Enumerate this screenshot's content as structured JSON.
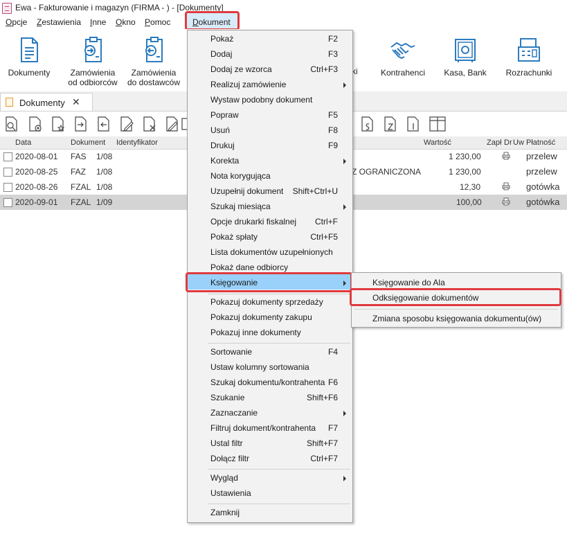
{
  "window": {
    "title": "Ewa - Fakturowanie i magazyn (FIRMA - ) - [Dokumenty]"
  },
  "menubar": [
    "Opcje",
    "Zestawienia",
    "Inne",
    "Okno",
    "Pomoc",
    "Dokument"
  ],
  "ribbon": {
    "dokumenty": "Dokumenty",
    "zam_odb_1": "Zamówienia",
    "zam_odb_2": "od odbiorców",
    "zam_dost_1": "Zamówienia",
    "zam_dost_2": "do dostawców",
    "partial": "ki",
    "kontrahenci": "Kontrahenci",
    "kasa": "Kasa, Bank",
    "rozrachunki": "Rozrachunki"
  },
  "tab": {
    "label": "Dokumenty",
    "close": "✕"
  },
  "grid": {
    "headers": {
      "data": "Data",
      "dokument": "Dokument",
      "identyfikator": "Identyfikator",
      "wartosc": "Wartość",
      "zapl": "Zapł",
      "dr": "Dr",
      "uw": "Uw",
      "platnosc": "Płatność"
    },
    "rows": [
      {
        "date": "2020-08-01",
        "type": "FAS",
        "num": "1/08",
        "name": "",
        "value": "1 230,00",
        "printer": true,
        "payment": "przelew",
        "selected": false
      },
      {
        "date": "2020-08-25",
        "type": "FAZ",
        "num": "1/08",
        "name": "Z OGRANICZONA",
        "value": "1 230,00",
        "printer": false,
        "payment": "przelew",
        "selected": false
      },
      {
        "date": "2020-08-26",
        "type": "FZAL",
        "num": "1/08",
        "name": "",
        "value": "12,30",
        "printer": true,
        "payment": "gotówka",
        "selected": false
      },
      {
        "date": "2020-09-01",
        "type": "FZAL",
        "num": "1/09",
        "name": "",
        "value": "100,00",
        "printer": true,
        "payment": "gotówka",
        "selected": true
      }
    ]
  },
  "dropdown": {
    "items": [
      {
        "label": "Pokaż",
        "shortcut": "F2"
      },
      {
        "label": "Dodaj",
        "shortcut": "F3"
      },
      {
        "label": "Dodaj ze wzorca",
        "shortcut": "Ctrl+F3"
      },
      {
        "label": "Realizuj zamówienie",
        "shortcut": ""
      },
      {
        "label": "Wystaw podobny dokument",
        "shortcut": ""
      },
      {
        "label": "Popraw",
        "shortcut": "F5"
      },
      {
        "label": "Usuń",
        "shortcut": "F8"
      },
      {
        "label": "Drukuj",
        "shortcut": "F9"
      },
      {
        "label": "Korekta",
        "shortcut": ""
      },
      {
        "label": "Nota korygująca",
        "shortcut": ""
      },
      {
        "label": "Uzupełnij dokument",
        "shortcut": "Shift+Ctrl+U"
      },
      {
        "label": "Szukaj miesiąca",
        "shortcut": ""
      },
      {
        "label": "Opcje drukarki fiskalnej",
        "shortcut": "Ctrl+F"
      },
      {
        "label": "Pokaż spłaty",
        "shortcut": "Ctrl+F5"
      },
      {
        "label": "Lista dokumentów uzupełnionych",
        "shortcut": ""
      },
      {
        "label": "Pokaż dane odbiorcy",
        "shortcut": ""
      },
      {
        "label": "Księgowanie",
        "shortcut": ""
      },
      {
        "label": "Pokazuj dokumenty sprzedaży",
        "shortcut": ""
      },
      {
        "label": "Pokazuj dokumenty zakupu",
        "shortcut": ""
      },
      {
        "label": "Pokazuj inne dokumenty",
        "shortcut": ""
      },
      {
        "label": "Sortowanie",
        "shortcut": "F4"
      },
      {
        "label": "Ustaw kolumny sortowania",
        "shortcut": ""
      },
      {
        "label": "Szukaj dokumentu/kontrahenta",
        "shortcut": "F6"
      },
      {
        "label": "Szukanie",
        "shortcut": "Shift+F6"
      },
      {
        "label": "Zaznaczanie",
        "shortcut": ""
      },
      {
        "label": "Filtruj dokument/kontrahenta",
        "shortcut": "F7"
      },
      {
        "label": "Ustal filtr",
        "shortcut": "Shift+F7"
      },
      {
        "label": "Dołącz filtr",
        "shortcut": "Ctrl+F7"
      },
      {
        "label": "Wygląd",
        "shortcut": ""
      },
      {
        "label": "Ustawienia",
        "shortcut": ""
      },
      {
        "label": "Zamknij",
        "shortcut": ""
      }
    ]
  },
  "submenu": {
    "items": [
      {
        "label": "Księgowanie do Ala"
      },
      {
        "label": "Odksięgowanie dokumentów"
      },
      {
        "label": "Zmiana sposobu księgowania dokumentu(ów)"
      }
    ]
  },
  "colors": {
    "highlight": "#99d1fa",
    "annotation": "#e03a3e",
    "icon_blue": "#2b7bbf",
    "menu_bg": "#f2f2f2"
  }
}
